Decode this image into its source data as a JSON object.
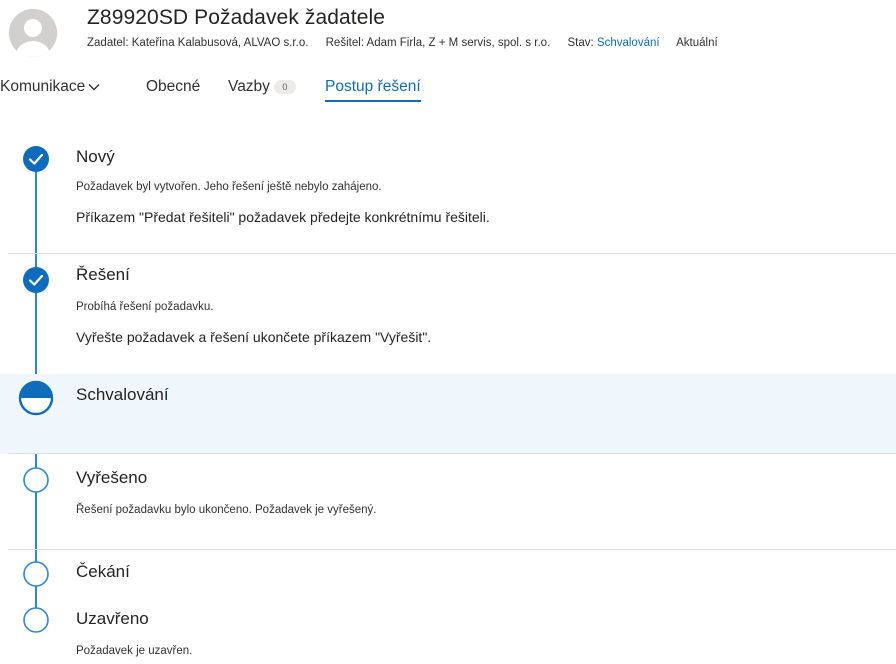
{
  "header": {
    "title": "Z89920SD Požadavek žadatele",
    "requester_label": "Žadatel:",
    "requester_value": "Kateřina Kalabusová, ALVAO s.r.o.",
    "solver_label": "Řešitel:",
    "solver_value": "Adam Firla, Z + M servis, spol. s r.o.",
    "status_label": "Stav:",
    "status_value": "Schvalování",
    "trailing": "Aktuální"
  },
  "tabs": [
    {
      "label": "Komunikace",
      "has_dropdown": true,
      "active": false
    },
    {
      "label": "Obecné",
      "active": false
    },
    {
      "label": "Vazby",
      "badge": "0",
      "active": false
    },
    {
      "label": "Postup řešení",
      "active": true
    }
  ],
  "steps": [
    {
      "state": "completed",
      "title": "Nový",
      "description": "Požadavek byl vytvořen. Jeho řešení ještě nebylo zahájeno.",
      "instruction": "Příkazem \"Předat řešiteli\" požadavek předejte konkrétnímu řešiteli."
    },
    {
      "state": "completed",
      "title": "Řešení",
      "description": "Probíhá řešení požadavku.",
      "instruction": "Vyřešte požadavek a řešení ukončete příkazem \"Vyřešit\"."
    },
    {
      "state": "current",
      "title": "Schvalování",
      "description": "",
      "instruction": ""
    },
    {
      "state": "pending",
      "title": "Vyřešeno",
      "description": "Řešení požadavku bylo ukončeno. Požadavek je vyřešený.",
      "instruction": ""
    },
    {
      "state": "pending",
      "title": "Čekání",
      "description": "",
      "instruction": ""
    },
    {
      "state": "pending",
      "title": "Uzavřeno",
      "description": "Požadavek je uzavřen.",
      "instruction": ""
    }
  ],
  "colors": {
    "accent": "#0f6cbd",
    "timeline": "#2b88d8",
    "current_bg": "#eff6fc",
    "divider": "#e1dfdd"
  },
  "icons": {
    "completed": "checkmark-circle-icon",
    "current": "half-filled-circle-icon",
    "pending": "empty-circle-icon",
    "avatar": "person-icon",
    "dropdown": "chevron-down-icon"
  }
}
